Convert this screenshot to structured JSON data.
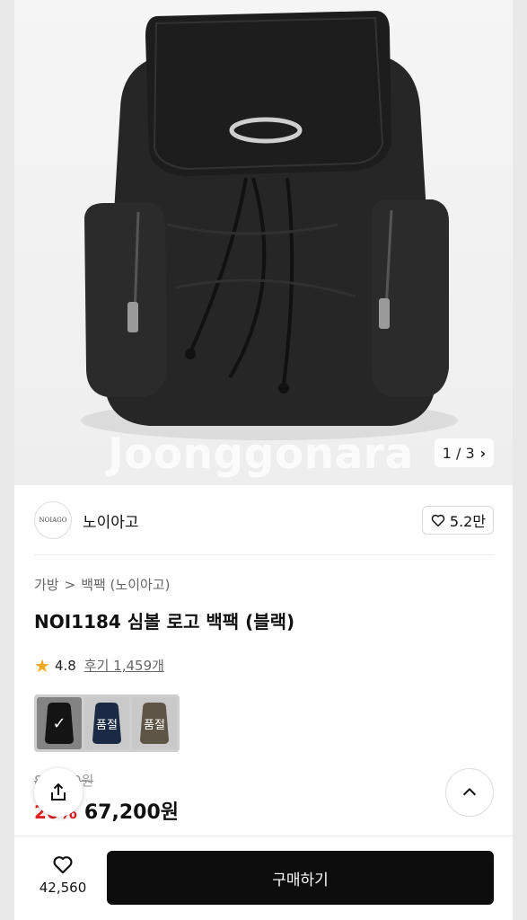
{
  "hero": {
    "watermark": "Joonggonara",
    "counter": "1 / 3",
    "counter_icon": "chevron-right-icon"
  },
  "shop": {
    "logo_text": "NOIAGO",
    "name": "노이아고",
    "like_count": "5.2만"
  },
  "product": {
    "breadcrumb": [
      "가방",
      "백팩 (노이아고)"
    ],
    "breadcrumb_separator": ">",
    "title": "NOI1184 심볼 로고 백팩 (블랙)",
    "rating": "4.8",
    "reviews": "후기 1,459개",
    "swatches": [
      {
        "color": "#1f1f1f",
        "label": "✓",
        "state": "selected"
      },
      {
        "color": "#1b2a44",
        "label": "품절",
        "state": "sold-out"
      },
      {
        "color": "#5e5546",
        "label": "품절",
        "state": "sold-out"
      }
    ],
    "price_original": "84,000원",
    "discount": "20%",
    "price": "67,200원"
  },
  "bottom": {
    "wish_count": "42,560",
    "buy_label": "구매하기"
  },
  "colors": {
    "accent_discount": "#e02020",
    "star": "#f5a623",
    "buy_button": "#0d0d0d"
  }
}
